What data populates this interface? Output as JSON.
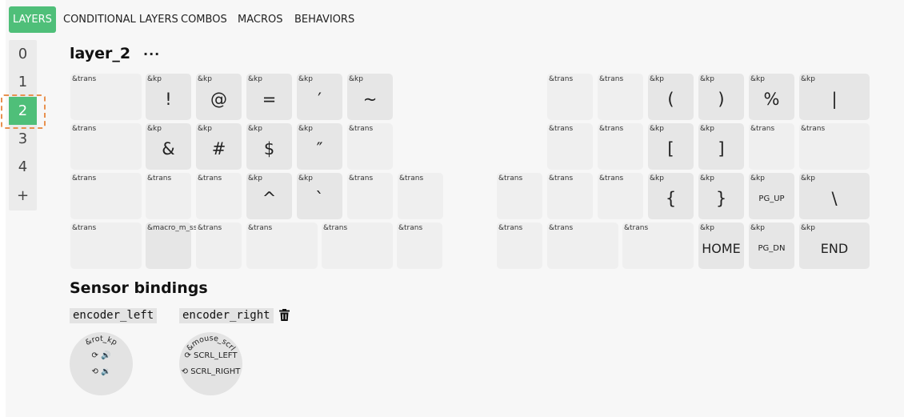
{
  "tabs": [
    {
      "label": "LAYERS",
      "active": true
    },
    {
      "label": "CONDITIONAL LAYERS",
      "active": false
    },
    {
      "label": "COMBOS",
      "active": false
    },
    {
      "label": "MACROS",
      "active": false
    },
    {
      "label": "BEHAVIORS",
      "active": false
    }
  ],
  "layers": {
    "items": [
      "0",
      "1",
      "2",
      "3",
      "4"
    ],
    "selected": "2",
    "add_label": "+"
  },
  "layer": {
    "title": "layer_2",
    "menu_label": "···"
  },
  "keys": [
    {
      "behavior": "&trans",
      "legend": ""
    },
    {
      "behavior": "&kp",
      "legend": "!"
    },
    {
      "behavior": "&kp",
      "legend": "@"
    },
    {
      "behavior": "&kp",
      "legend": "="
    },
    {
      "behavior": "&kp",
      "legend": "′"
    },
    {
      "behavior": "&kp",
      "legend": "~"
    },
    {
      "behavior": "&trans",
      "legend": ""
    },
    {
      "behavior": "&trans",
      "legend": ""
    },
    {
      "behavior": "&kp",
      "legend": "("
    },
    {
      "behavior": "&kp",
      "legend": ")"
    },
    {
      "behavior": "&kp",
      "legend": "%"
    },
    {
      "behavior": "&kp",
      "legend": "|"
    },
    {
      "behavior": "&trans",
      "legend": ""
    },
    {
      "behavior": "&kp",
      "legend": "&"
    },
    {
      "behavior": "&kp",
      "legend": "#"
    },
    {
      "behavior": "&kp",
      "legend": "$"
    },
    {
      "behavior": "&kp",
      "legend": "″"
    },
    {
      "behavior": "&trans",
      "legend": ""
    },
    {
      "behavior": "&trans",
      "legend": ""
    },
    {
      "behavior": "&trans",
      "legend": ""
    },
    {
      "behavior": "&kp",
      "legend": "["
    },
    {
      "behavior": "&kp",
      "legend": "]"
    },
    {
      "behavior": "&trans",
      "legend": ""
    },
    {
      "behavior": "&trans",
      "legend": ""
    },
    {
      "behavior": "&trans",
      "legend": ""
    },
    {
      "behavior": "&trans",
      "legend": ""
    },
    {
      "behavior": "&trans",
      "legend": ""
    },
    {
      "behavior": "&kp",
      "legend": "^"
    },
    {
      "behavior": "&kp",
      "legend": "`"
    },
    {
      "behavior": "&trans",
      "legend": ""
    },
    {
      "behavior": "&trans",
      "legend": ""
    },
    {
      "behavior": "&trans",
      "legend": ""
    },
    {
      "behavior": "&trans",
      "legend": ""
    },
    {
      "behavior": "&trans",
      "legend": ""
    },
    {
      "behavior": "&kp",
      "legend": "{"
    },
    {
      "behavior": "&kp",
      "legend": "}"
    },
    {
      "behavior": "&kp",
      "legend": "PG_UP"
    },
    {
      "behavior": "&kp",
      "legend": "\\"
    },
    {
      "behavior": "&trans",
      "legend": ""
    },
    {
      "behavior": "&macro_m_ss",
      "legend": ""
    },
    {
      "behavior": "&trans",
      "legend": ""
    },
    {
      "behavior": "&trans",
      "legend": ""
    },
    {
      "behavior": "&trans",
      "legend": ""
    },
    {
      "behavior": "&trans",
      "legend": ""
    },
    {
      "behavior": "&trans",
      "legend": ""
    },
    {
      "behavior": "&trans",
      "legend": ""
    },
    {
      "behavior": "&trans",
      "legend": ""
    },
    {
      "behavior": "&kp",
      "legend": "HOME"
    },
    {
      "behavior": "&kp",
      "legend": "PG_DN"
    },
    {
      "behavior": "&kp",
      "legend": "END"
    }
  ],
  "sensors": {
    "title": "Sensor bindings",
    "items": [
      {
        "name": "encoder_left",
        "behavior": "&rot_kp",
        "cw": "⟳ 🔊",
        "ccw": "⟲ 🔉"
      },
      {
        "name": "encoder_right",
        "behavior": "&mouse_scrl",
        "cw": "⟳ SCRL_LEFT",
        "ccw": "⟲ SCRL_RIGHT"
      }
    ],
    "delete_icon": "trash-icon"
  },
  "colors": {
    "accent": "#4fbf79",
    "selection_outline": "#e8914f"
  }
}
